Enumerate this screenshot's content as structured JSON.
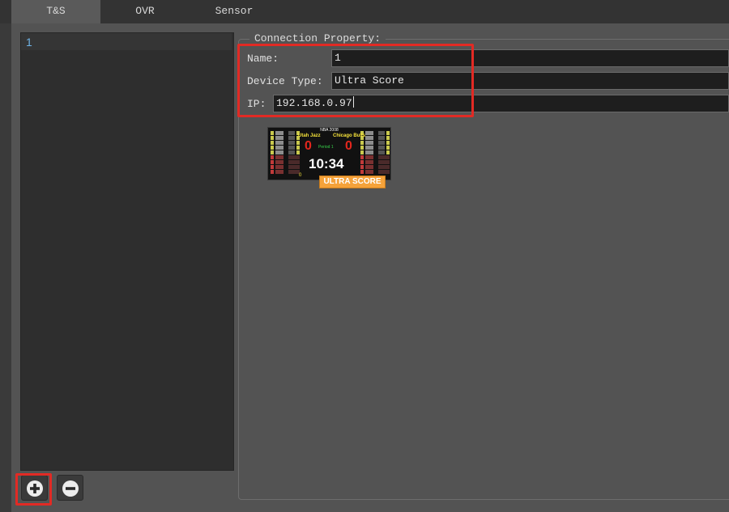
{
  "tabs": [
    {
      "label": "T&S",
      "active": true
    },
    {
      "label": "OVR",
      "active": false
    },
    {
      "label": "Sensor",
      "active": false
    }
  ],
  "device_list": {
    "items": [
      "1"
    ]
  },
  "toolbar": {
    "add_icon": "plus-circle-icon",
    "remove_icon": "minus-circle-icon"
  },
  "connection": {
    "group_title": "Connection Property:",
    "name_label": "Name:",
    "name_value": "1",
    "device_type_label": "Device Type:",
    "device_type_value": "Ultra Score",
    "ip_label": "IP:",
    "ip_value": "192.168.0.97"
  },
  "device_preview": {
    "title": "NBA 2008",
    "home_team": "Utah Jazz",
    "away_team": "Chicago Bulls",
    "home_score": "0",
    "away_score": "0",
    "period": "Period 1",
    "clock": "10:34",
    "bottom_value": "0",
    "badge": "ULTRA SCORE"
  },
  "colors": {
    "highlight": "#e22a24",
    "panel": "#535353",
    "list_text": "#6fb3e6"
  }
}
